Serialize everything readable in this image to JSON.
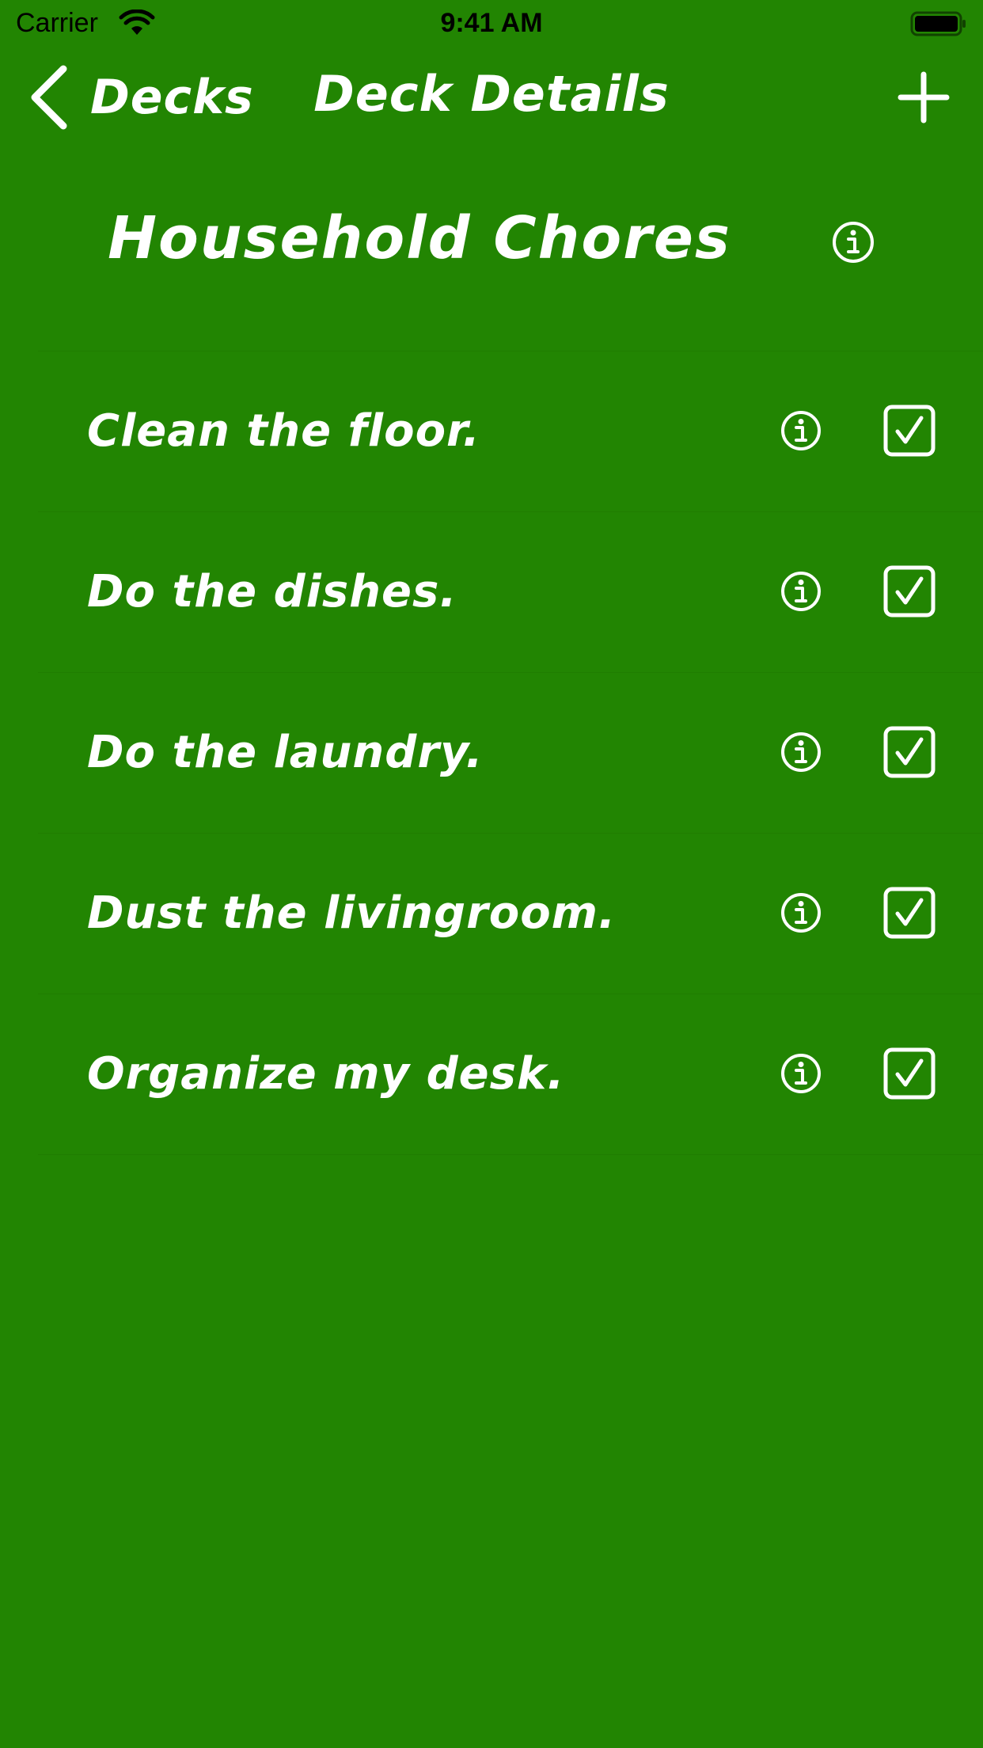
{
  "status_bar": {
    "carrier": "Carrier",
    "time": "9:41 AM",
    "icons": [
      "wifi-icon",
      "battery-icon"
    ]
  },
  "nav_bar": {
    "back_label": "Decks",
    "title": "Deck Details",
    "icons": [
      "chevron-left-icon",
      "plus-icon"
    ]
  },
  "deck": {
    "title": "Household Chores",
    "info_icon": "info-icon"
  },
  "items": [
    {
      "label": "Clean the floor.",
      "checked": true
    },
    {
      "label": "Do the dishes.",
      "checked": true
    },
    {
      "label": "Do the laundry.",
      "checked": true
    },
    {
      "label": "Dust the livingroom.",
      "checked": true
    },
    {
      "label": "Organize my desk.",
      "checked": true
    }
  ],
  "colors": {
    "background": "#228502",
    "foreground": "#ffffff"
  }
}
